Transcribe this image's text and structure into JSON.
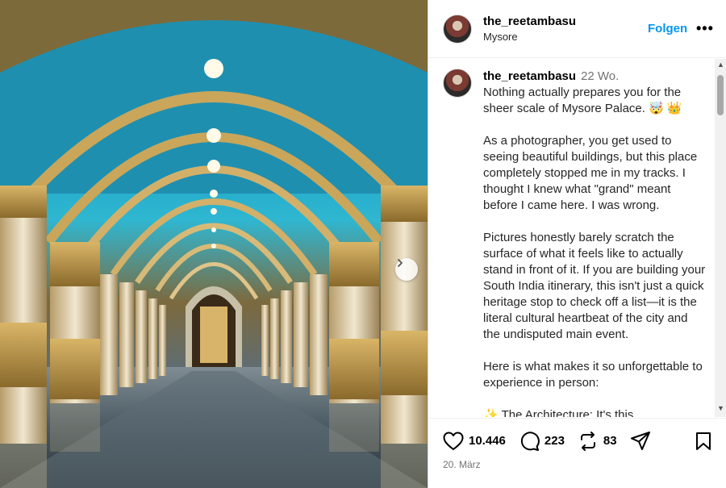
{
  "post": {
    "username": "the_reetambasu",
    "location": "Mysore",
    "follow_label": "Folgen",
    "more_label": "•••"
  },
  "caption": {
    "username": "the_reetambasu",
    "time_ago": "22 Wo.",
    "paragraphs": [
      "Nothing actually prepares you for the sheer scale of Mysore Palace. 🤯 👑",
      "As a photographer, you get used to seeing beautiful buildings, but this place completely stopped me in my tracks. I thought I knew what \"grand\" meant before I came here. I was wrong.",
      "Pictures honestly barely scratch the surface of what it feels like to actually stand in front of it. If you are building your South India itinerary, this isn't just a quick heritage stop to check off a list—it is the literal cultural heartbeat of the city and the undisputed main event.",
      "Here is what makes it so unforgettable to experience in person:",
      "✨ The Architecture: It's this"
    ]
  },
  "stats": {
    "likes": "10.446",
    "comments": "223",
    "reposts": "83"
  },
  "date": "20. März",
  "icons": {
    "like": "heart-icon",
    "comment": "comment-icon",
    "repost": "repost-icon",
    "share": "share-icon",
    "save": "bookmark-icon",
    "next": "chevron-right-icon"
  },
  "colors": {
    "accent": "#0095f6",
    "muted": "#737373"
  }
}
